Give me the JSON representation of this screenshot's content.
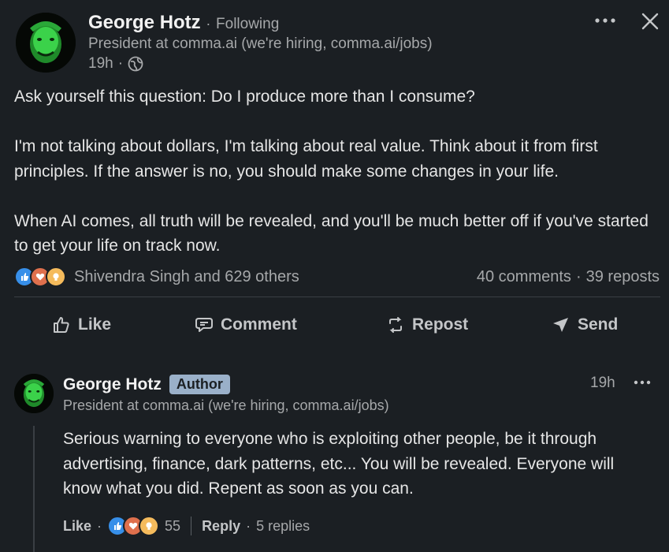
{
  "post": {
    "author_name": "George Hotz",
    "follow_status": "Following",
    "headline": "President at comma.ai (we're hiring, comma.ai/jobs)",
    "time": "19h",
    "paragraphs": [
      "Ask yourself this question: Do I produce more than I consume?",
      "I'm not talking about dollars, I'm talking about real value. Think about it from first principles. If the answer is no, you should make some changes in your life.",
      "When AI comes, all truth will be revealed, and you'll be much better off if you've started to get your life on track now."
    ],
    "reactions_text": "Shivendra Singh and 629 others",
    "comments_count": "40 comments",
    "reposts_count": "39 reposts",
    "separator": "·"
  },
  "actions": {
    "like": "Like",
    "comment": "Comment",
    "repost": "Repost",
    "send": "Send"
  },
  "comment": {
    "author_name": "George Hotz",
    "badge": "Author",
    "headline": "President at comma.ai (we're hiring, comma.ai/jobs)",
    "time": "19h",
    "text": "Serious warning to everyone who is exploiting other people, be it through advertising, finance, dark patterns, etc... You will be revealed. Everyone will know what you did. Repent as soon as you can.",
    "like_label": "Like",
    "reaction_count": "55",
    "reply_label": "Reply",
    "replies_count": "5 replies"
  },
  "icons": [
    "more-icon",
    "close-icon",
    "globe-icon",
    "like-icon",
    "comment-icon",
    "repost-icon",
    "send-icon",
    "reaction-like-icon",
    "reaction-love-icon",
    "reaction-insightful-icon"
  ],
  "colors": {
    "background": "#1b1f23",
    "text": "#e9e9e9",
    "muted": "#a6a8aa",
    "like_reaction": "#378fe9",
    "love_reaction": "#df704d",
    "insightful_reaction": "#f5bb5c",
    "author_badge": "#9ab0c9"
  }
}
